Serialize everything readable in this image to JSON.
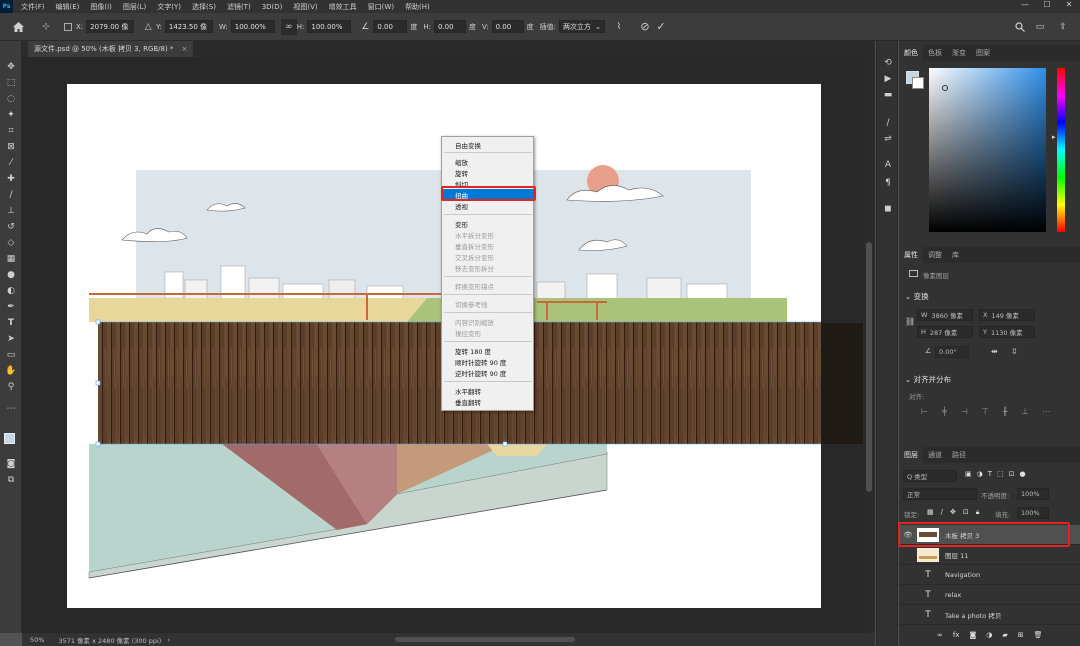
{
  "menubar": {
    "logo": "Ps",
    "items": [
      "文件(F)",
      "编辑(E)",
      "图像(I)",
      "图层(L)",
      "文字(Y)",
      "选择(S)",
      "滤镜(T)",
      "3D(D)",
      "视图(V)",
      "增效工具",
      "窗口(W)",
      "帮助(H)"
    ],
    "window_controls": [
      "—",
      "☐",
      "✕"
    ]
  },
  "options": {
    "x_label": "X:",
    "x_value": "2079.00 像",
    "y_label": "Y:",
    "y_value": "1423.50 像",
    "w_label": "W:",
    "w_value": "100.00%",
    "h_label": "H:",
    "h_value": "100.00%",
    "angle_value": "0.00",
    "deg": "度",
    "hskew_label": "H:",
    "hskew_value": "0.00",
    "vskew_label": "V:",
    "vskew_value": "0.00",
    "interp_label": "插值:",
    "interp_value": "两次立方"
  },
  "document": {
    "tab_title": "源文件.psd @ 50% (木板 拷贝 3, RGB/8) *",
    "tab_close": "×"
  },
  "status": {
    "zoom": "50%",
    "info": "3571 像素 x 2480 像素 (300 ppi)"
  },
  "context_menu": {
    "items": [
      {
        "label": "自由变换",
        "disabled": false
      },
      {
        "label": "缩放",
        "disabled": false
      },
      {
        "label": "旋转",
        "disabled": false
      },
      {
        "label": "斜切",
        "disabled": false
      },
      {
        "label": "扭曲",
        "disabled": false
      },
      {
        "label": "透视",
        "disabled": false
      },
      {
        "label": "变形",
        "disabled": false
      },
      {
        "label": "水平拆分变形",
        "disabled": true
      },
      {
        "label": "垂直拆分变形",
        "disabled": true
      },
      {
        "label": "交叉拆分变形",
        "disabled": true
      },
      {
        "label": "移去变形拆分",
        "disabled": true
      },
      {
        "label": "转换变形锚点",
        "disabled": true
      },
      {
        "label": "切换参考线",
        "disabled": true
      },
      {
        "label": "内容识别缩放",
        "disabled": true
      },
      {
        "label": "操控变形",
        "disabled": true
      },
      {
        "label": "旋转 180 度",
        "disabled": false
      },
      {
        "label": "顺时针旋转 90 度",
        "disabled": false
      },
      {
        "label": "逆时针旋转 90 度",
        "disabled": false
      },
      {
        "label": "水平翻转",
        "disabled": false
      },
      {
        "label": "垂直翻转",
        "disabled": false
      }
    ],
    "highlighted": "扭曲"
  },
  "color_panel": {
    "tabs": [
      "颜色",
      "色板",
      "渐变",
      "图案"
    ]
  },
  "properties_panel": {
    "tabs": [
      "属性",
      "调整",
      "库"
    ],
    "layer_kind": "像素图层",
    "transform_title": "变换",
    "w_label": "W",
    "w_value": "3860 像素",
    "x_label": "X",
    "x_value": "149 像素",
    "h_label": "H",
    "h_value": "287 像素",
    "y_label": "Y",
    "y_value": "1130 像素",
    "angle_value": "0.00°",
    "align_title": "对齐并分布",
    "align_label": "对齐:"
  },
  "layers_panel": {
    "tabs": [
      "图层",
      "通道",
      "路径"
    ],
    "filter_kind": "Q 类型",
    "blend_mode": "正常",
    "opacity_label": "不透明度:",
    "opacity_value": "100%",
    "lock_label": "锁定:",
    "fill_label": "填充:",
    "fill_value": "100%",
    "layers": [
      {
        "name": "木板 拷贝 3",
        "type": "image",
        "visible": true,
        "selected": true
      },
      {
        "name": "图层 11",
        "type": "image",
        "visible": false,
        "selected": false
      },
      {
        "name": "Navigation",
        "type": "text",
        "visible": false,
        "selected": false
      },
      {
        "name": "relax",
        "type": "text",
        "visible": false,
        "selected": false
      },
      {
        "name": "Take a photo 拷贝",
        "type": "text",
        "visible": false,
        "selected": false
      }
    ]
  },
  "colors": {
    "highlight": "#0078d7",
    "callout": "#e52421",
    "foreground": "#c4d7e6",
    "sun": "#e8a08c"
  }
}
